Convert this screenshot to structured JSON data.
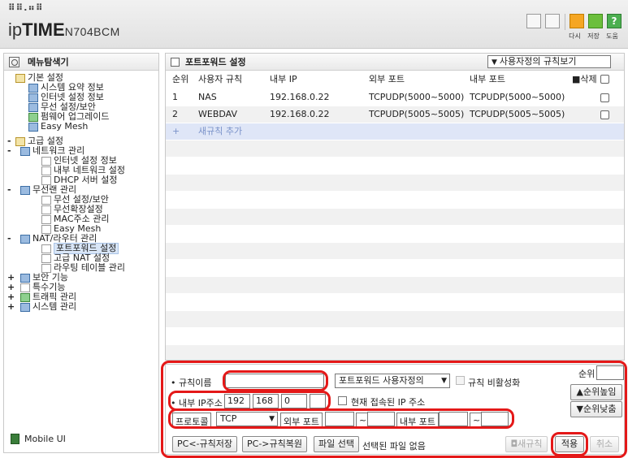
{
  "header": {
    "logo_small": "⠿⠿.⠶⠿",
    "logo_prefix": "ip",
    "logo_brand": "TIM",
    "logo_e": "E",
    "logo_model": "N704BCM",
    "actions": [
      "다시",
      "저장",
      "도움"
    ]
  },
  "sidebar": {
    "title": "메뉴탐색기",
    "items": [
      {
        "label": "기본 설정",
        "level": 0,
        "exp": "",
        "icon": "folder"
      },
      {
        "label": "시스템 요약 정보",
        "level": 1,
        "icon": "b"
      },
      {
        "label": "인터넷 설정 정보",
        "level": 1,
        "icon": "b"
      },
      {
        "label": "무선 설정/보안",
        "level": 1,
        "icon": "b"
      },
      {
        "label": "펌웨어 업그레이드",
        "level": 1,
        "icon": "g"
      },
      {
        "label": "Easy Mesh",
        "level": 1,
        "icon": "b"
      },
      {
        "label": "고급 설정",
        "level": 0,
        "exp": "-",
        "icon": "folder"
      },
      {
        "label": "네트워크 관리",
        "level": 1,
        "exp": "-",
        "icon": "b"
      },
      {
        "label": "인터넷 설정 정보",
        "level": 2,
        "icon": "page"
      },
      {
        "label": "내부 네트워크 설정",
        "level": 2,
        "icon": "page"
      },
      {
        "label": "DHCP 서버 설정",
        "level": 2,
        "icon": "page"
      },
      {
        "label": "무선랜 관리",
        "level": 1,
        "exp": "-",
        "icon": "b"
      },
      {
        "label": "무선 설정/보안",
        "level": 2,
        "icon": "page"
      },
      {
        "label": "무선확장설정",
        "level": 2,
        "icon": "page"
      },
      {
        "label": "MAC주소 관리",
        "level": 2,
        "icon": "page"
      },
      {
        "label": "Easy Mesh",
        "level": 2,
        "icon": "page"
      },
      {
        "label": "NAT/라우터 관리",
        "level": 1,
        "exp": "-",
        "icon": "b"
      },
      {
        "label": "포트포워드 설정",
        "level": 2,
        "icon": "page",
        "selected": true
      },
      {
        "label": "고급 NAT 설정",
        "level": 2,
        "icon": "page"
      },
      {
        "label": "라우팅 테이블 관리",
        "level": 2,
        "icon": "page"
      },
      {
        "label": "보안 기능",
        "level": 1,
        "exp": "+",
        "icon": "b"
      },
      {
        "label": "특수기능",
        "level": 1,
        "exp": "+",
        "icon": "page"
      },
      {
        "label": "트래픽 관리",
        "level": 1,
        "exp": "+",
        "icon": "g"
      },
      {
        "label": "시스템 관리",
        "level": 1,
        "exp": "+",
        "icon": "b"
      }
    ],
    "mobile": "Mobile UI"
  },
  "main": {
    "title": "포트포워드 설정",
    "view_select": "사용자정의 규칙보기",
    "columns": {
      "order": "순위",
      "rule": "사용자 규칙",
      "ip": "내부 IP",
      "ext": "외부 포트",
      "int": "내부 포트",
      "del": "삭제"
    },
    "rows": [
      {
        "order": "1",
        "rule": "NAS",
        "ip": "192.168.0.22",
        "ext": "TCPUDP(5000~5000)",
        "int": "TCPUDP(5000~5000)"
      },
      {
        "order": "2",
        "rule": "WEBDAV",
        "ip": "192.168.0.22",
        "ext": "TCPUDP(5005~5005)",
        "int": "TCPUDP(5005~5005)"
      }
    ],
    "add_plus": "+",
    "add_label": "새규칙 추가"
  },
  "form": {
    "rule_name_label": "규칙이름",
    "rule_name_value": "",
    "type_select": "포트포워드 사용자정의",
    "disable_label": "규칙 비활성화",
    "order_label": "순위",
    "up_button": "순위높임",
    "down_button": "순위낮춤",
    "ip_label": "내부 IP주소",
    "ip": [
      "192",
      "168",
      "0",
      ""
    ],
    "current_ip_label": "현재 접속된 IP 주소",
    "protocol_label": "프로토콜",
    "protocol_value": "TCP",
    "ext_port_label": "외부 포트",
    "int_port_label": "내부 포트",
    "tilde": "~",
    "pc_save": "PC<-규칙저장",
    "pc_restore": "PC->규칙복원",
    "file_select": "파일 선택",
    "file_none": "선택된 파일 없음",
    "new_rule": "새규칙",
    "apply": "적용",
    "cancel": "취소"
  }
}
